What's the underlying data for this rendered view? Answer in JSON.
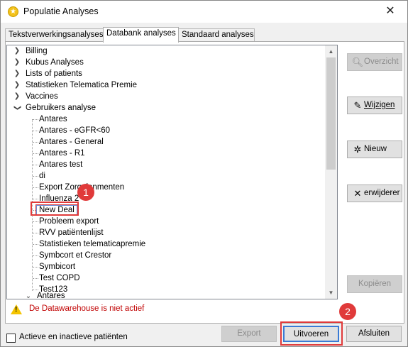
{
  "window": {
    "title": "Populatie Analyses",
    "close_label": "✕"
  },
  "tabs": [
    {
      "label": "Tekstverwerkingsanalyses",
      "active": false
    },
    {
      "label": "Databank analyses",
      "active": true
    },
    {
      "label": "Standaard analyses",
      "active": false
    }
  ],
  "tree": {
    "top_level": [
      {
        "label": "Billing",
        "expanded": false
      },
      {
        "label": "Kubus Analyses",
        "expanded": false
      },
      {
        "label": "Lists of patients",
        "expanded": false
      },
      {
        "label": "Statistieken Telematica Premie",
        "expanded": false
      },
      {
        "label": "Vaccines",
        "expanded": false
      },
      {
        "label": "Gebruikers analyse",
        "expanded": true
      }
    ],
    "children": [
      "Antares",
      "Antares - eGFR<60",
      "Antares - General",
      "Antares - R1",
      "Antares test",
      "di",
      "Export Zorgplanmenten",
      "Influenza 2",
      "New Deal",
      "Probleem export",
      "RVV patiëntenlijst",
      "Statistieken telematicapremie",
      "Symbcort et Crestor",
      "Symbicort",
      "Test COPD",
      "Test123"
    ],
    "selected": "New Deal",
    "partial_bottom_label": "Antares"
  },
  "side_buttons": {
    "overzicht": "Overzicht",
    "wijzigen": "Wijzigen",
    "nieuw": "Nieuw",
    "verwijderen": "erwijderer",
    "kopieren": "Kopiëren"
  },
  "warning": {
    "icon": "warning-icon",
    "text": "De Datawarehouse is niet actief"
  },
  "bottom": {
    "checkbox_label": "Actieve en inactieve patiënten",
    "checkbox_checked": false,
    "export_label": "Export",
    "uitvoeren_label": "Uitvoeren",
    "afsluiten_label": "Afsluiten"
  },
  "callouts": {
    "one": "1",
    "two": "2"
  },
  "colors": {
    "accent": "#3a7bd5",
    "callout": "#e03a3a",
    "warning_text": "#c00000"
  }
}
